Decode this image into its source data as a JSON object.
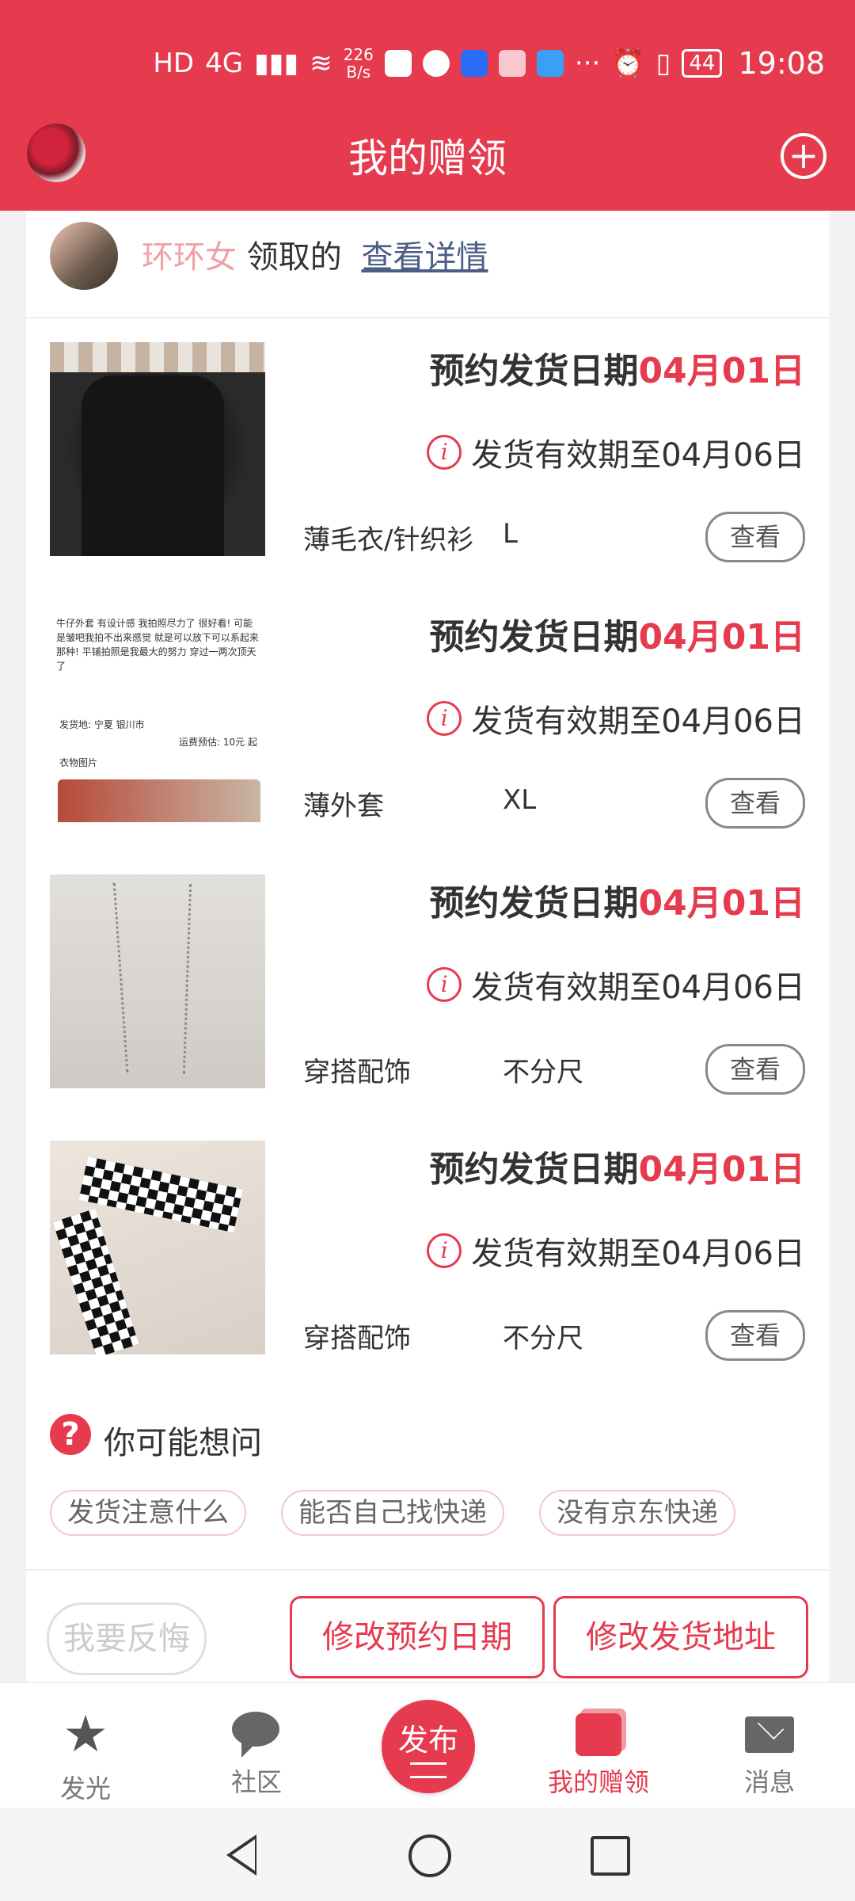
{
  "status_bar": {
    "hd": "HD",
    "network": "4G",
    "speed_top": "226",
    "speed_bottom": "B/s",
    "battery": "44",
    "time": "19:08",
    "more": "···"
  },
  "header": {
    "title": "我的赠领",
    "plus_icon": "plus-circle-icon"
  },
  "sender": {
    "name": "环环女",
    "action": "领取的",
    "link": "查看详情"
  },
  "items": [
    {
      "date_label": "预约发货日期",
      "date_value": "04月01日",
      "valid": "发货有效期至04月06日",
      "category": "薄毛衣/针织衫",
      "size": "L",
      "button": "查看"
    },
    {
      "date_label": "预约发货日期",
      "date_value": "04月01日",
      "valid": "发货有效期至04月06日",
      "category": "薄外套",
      "size": "XL",
      "button": "查看"
    },
    {
      "date_label": "预约发货日期",
      "date_value": "04月01日",
      "valid": "发货有效期至04月06日",
      "category": "穿搭配饰",
      "size": "不分尺",
      "button": "查看"
    },
    {
      "date_label": "预约发货日期",
      "date_value": "04月01日",
      "valid": "发货有效期至04月06日",
      "category": "穿搭配饰",
      "size": "不分尺",
      "button": "查看"
    }
  ],
  "thumb_text": {
    "desc": "牛仔外套 有设计感 我拍照尽力了 很好看! 可能是皱吧我拍不出来感觉 就是可以放下可以系起来那种! 平铺拍照是我最大的努力 穿过一两次顶天了",
    "ship_from": "发货地: 宁夏 银川市",
    "fee": "运费预估: 10元 起",
    "photos": "衣物图片"
  },
  "faq": {
    "title": "你可能想问",
    "chips": [
      "发货注意什么",
      "能否自己找快递",
      "没有京东快递"
    ]
  },
  "actions": {
    "regret": "我要反悔",
    "change_date": "修改预约日期",
    "change_address": "修改发货地址"
  },
  "tabs": [
    {
      "label": "发光",
      "icon": "star-icon"
    },
    {
      "label": "社区",
      "icon": "chat-bubble-icon"
    },
    {
      "label": "发布",
      "icon": "publish-icon"
    },
    {
      "label": "我的赠领",
      "icon": "gift-icon"
    },
    {
      "label": "消息",
      "icon": "mail-icon"
    }
  ],
  "colors": {
    "accent": "#e63a4e",
    "link": "#4c5d86",
    "name": "#f0a1a6"
  }
}
